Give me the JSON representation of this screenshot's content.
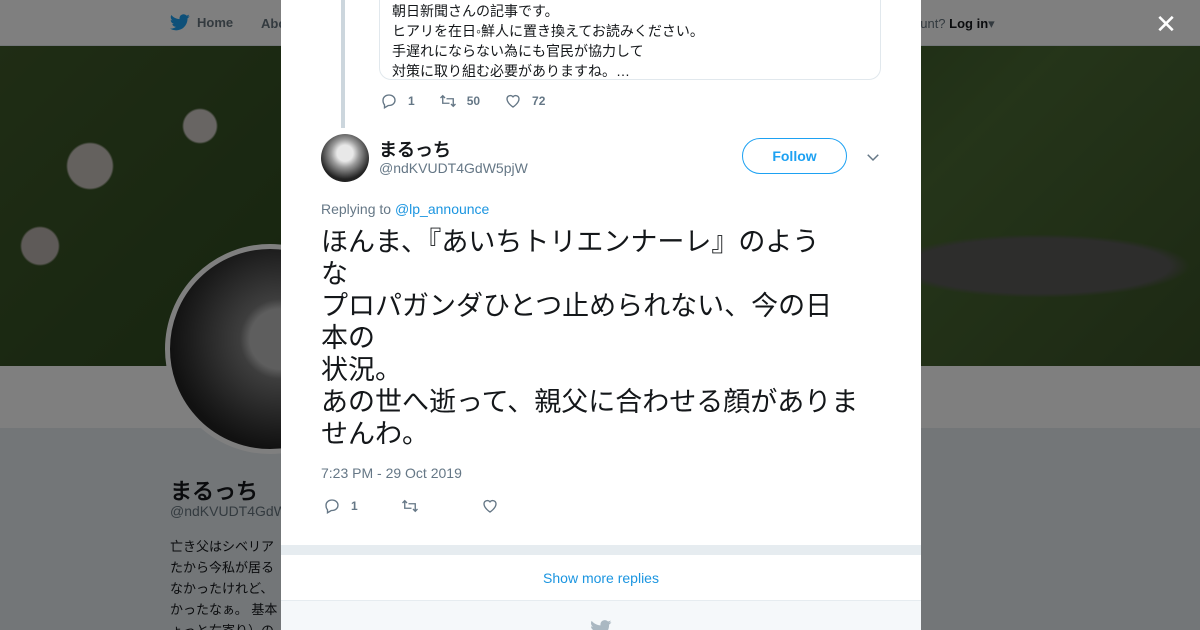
{
  "background": {
    "nav": {
      "home_label": "Home",
      "about_label": "Abo",
      "account_prompt": "ccount?",
      "login_label": "Log in"
    },
    "profile": {
      "name": "まるっち",
      "handle": "@ndKVUDT4GdW",
      "bio_lines": [
        "亡き父はシベリア",
        "たから今私が居る",
        "なかったけれど、",
        "かったなぁ。 基本",
        "ょっと右寄り）の"
      ]
    }
  },
  "modal": {
    "quoted": {
      "lines": [
        "朝日新聞さんの記事です。",
        "ヒアリを在日◦鮮人に置き換えてお読みください。",
        "手遅れにならない為にも官民が協力して",
        "対策に取り組む必要がありますね。…"
      ]
    },
    "parent_actions": {
      "reply_count": "1",
      "retweet_count": "50",
      "like_count": "72"
    },
    "tweet": {
      "name": "まるっち",
      "handle": "@ndKVUDT4GdW5pjW",
      "follow_label": "Follow",
      "replying_prefix": "Replying to",
      "replying_to": "@lp_announce",
      "text_lines": [
        "ほんま、『あいちトリエンナーレ』のよう",
        "な",
        "プロパガンダひとつ止められない、今の日",
        "本の",
        "状況。",
        "あの世へ逝って、親父に合わせる顔がありま",
        "せんわ。"
      ],
      "timestamp": "7:23 PM - 29 Oct 2019",
      "reply_count": "1"
    },
    "show_more_label": "Show more replies"
  },
  "colors": {
    "accent": "#1da1f2",
    "link": "#1b95e0",
    "text": "#14171a",
    "muted": "#657786"
  }
}
